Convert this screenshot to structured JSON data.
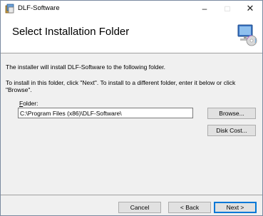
{
  "window": {
    "title": "DLF-Software",
    "minimize_glyph": "–",
    "maximize_glyph": "□",
    "close_glyph": "✕"
  },
  "header": {
    "title": "Select Installation Folder",
    "icon": "installer-computer-icon"
  },
  "body": {
    "intro_text": "The installer will install DLF-Software to the following folder.",
    "instruction_text": "To install in this folder, click \"Next\". To install to a different folder, enter it below or click \"Browse\".",
    "folder_label_mnemonic": "F",
    "folder_label_rest": "older:",
    "folder_value": "C:\\Program Files (x86)\\DLF-Software\\",
    "browse_label": "Browse...",
    "disk_cost_label": "Disk Cost..."
  },
  "footer": {
    "cancel_label": "Cancel",
    "back_label": "< Back",
    "next_label": "Next >"
  },
  "colors": {
    "accent": "#0078d7",
    "dialog_bg": "#f0f0f0",
    "header_bg": "#ffffff"
  }
}
